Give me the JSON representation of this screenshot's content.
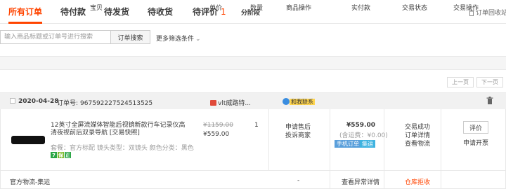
{
  "tabs": [
    {
      "label": "所有订单"
    },
    {
      "label": "待付款"
    },
    {
      "label": "待发货"
    },
    {
      "label": "待收货"
    },
    {
      "label": "待评价",
      "count": "1"
    },
    {
      "label": "分阶段"
    }
  ],
  "recycle_bin": "订单回收站",
  "search": {
    "placeholder": "输入商品标题或订单号进行搜索",
    "button": "订单搜索",
    "more_filters": "更多筛选条件"
  },
  "table_headers": [
    "宝贝",
    "单价",
    "数量",
    "商品操作",
    "实付款",
    "交易状态",
    "交易操作"
  ],
  "pager": {
    "prev": "上一页",
    "next": "下一页"
  },
  "order": {
    "date": "2020-04-28",
    "order_no_label": "订单号:",
    "order_no": "967592227524513525",
    "shop": "vlt威路特...",
    "contact": "和我联系",
    "product": {
      "title": "12英寸全屏流媒体智能后视镜新款行车记录仪高清夜视前后双录导航 [交易快照]",
      "sku": "套餐：官方标配   镜头类型：双镜头   颜色分类：黑色",
      "tags": [
        "7",
        "保",
        "正"
      ],
      "original_price": "¥1159.00",
      "price": "¥559.00",
      "quantity": "1",
      "item_ops": [
        "申请售后",
        "投诉商家"
      ]
    },
    "paid": {
      "amount": "¥559.00",
      "shipping": "(含运费：¥0.00)",
      "badges": [
        "手机订单",
        "集运"
      ]
    },
    "status": [
      "交易成功",
      "订单详情",
      "查看物流"
    ],
    "actions": {
      "evaluate": "评价",
      "invoice": "申请开票"
    },
    "footer": {
      "logistics": "官方物流-集运",
      "dash": "-",
      "abnormal": "查看异常详情",
      "warehouse_reject": "仓库拒收"
    }
  },
  "colors": {
    "accent": "#ff4400",
    "mobile_badge": "#5a9fdb",
    "jiyun_badge": "#3fb3e0"
  }
}
